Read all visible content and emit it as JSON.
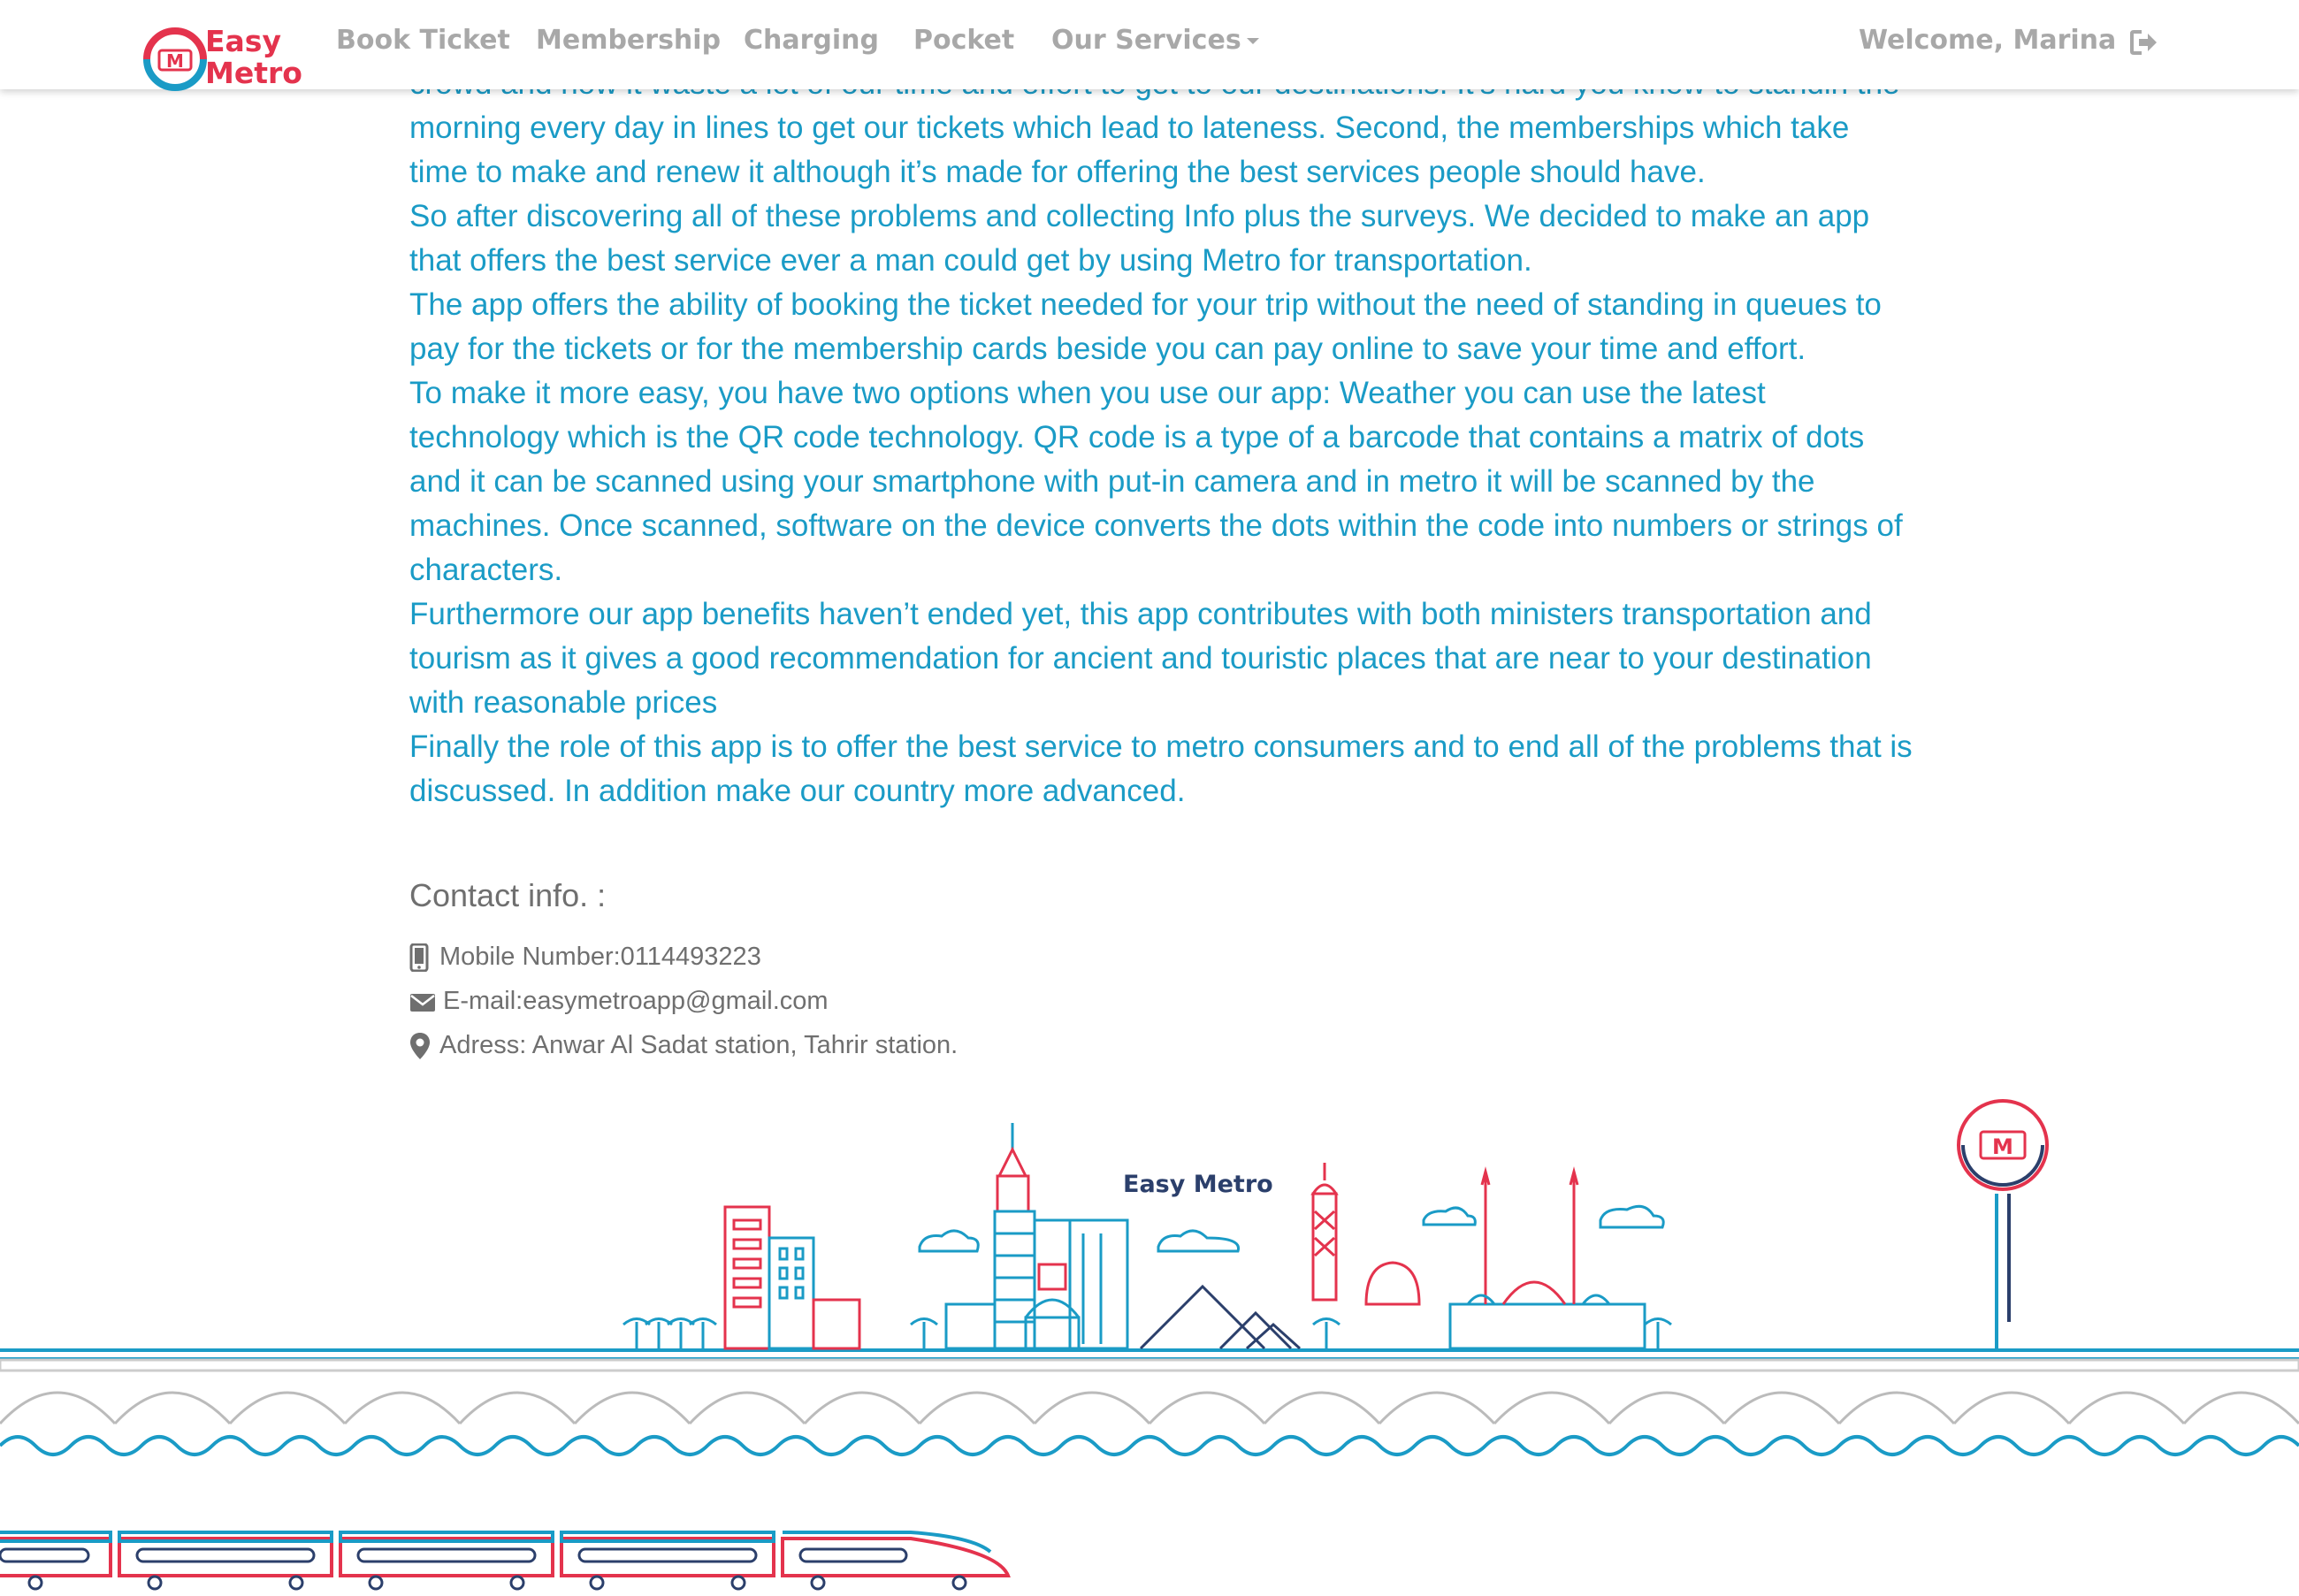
{
  "navbar": {
    "logo_line1": "Easy",
    "logo_line2": "Metro",
    "items": [
      "Book Ticket",
      "Membership",
      "Charging",
      "Pocket",
      "Our Services"
    ],
    "welcome": "Welcome, Marina",
    "signout_icon": "sign-out-icon"
  },
  "about": {
    "paragraphs": [
      "crowd and how it waste a lot of our time and effort to get to our destinations. It’s hard you know to standin the morning every day in lines to get our tickets which lead to lateness. Second, the memberships which take time to make and renew it although it’s made for offering the best services people should have.",
      "So after discovering all of these problems and collecting Info plus the surveys. We decided to make an app that offers the best service ever a man could get by using Metro for transportation.",
      "The app offers the ability of booking the ticket needed for your trip without the need of standing in queues to pay for the tickets or for the membership cards beside you can pay online to save your time and effort.",
      "To make it more easy, you have two options when you use our app: Weather you can use the latest technology which is the QR code technology. QR code is a type of a barcode that contains a matrix of dots and it can be scanned using your smartphone with put-in camera and in metro it will be scanned by the machines. Once scanned, software on the device converts the dots within the code into numbers or strings of characters.",
      "Furthermore our app benefits haven’t ended yet, this app contributes with both ministers transportation and tourism as it gives a good recommendation for ancient and touristic places that are near to your destination with reasonable prices",
      "Finally the role of this app is to offer the best service to metro consumers and to end all of the problems that is discussed. In addition make our country more advanced."
    ]
  },
  "contact": {
    "title": "Contact info. :",
    "mobile": "Mobile Number:0114493223",
    "email": "E-mail:easymetroapp@gmail.com",
    "address": "Adress: Anwar Al Sadat station, Tahrir station."
  },
  "footer": {
    "brand": "Easy Metro"
  },
  "colors": {
    "accent_blue": "#1a9bc6",
    "brand_red": "#e4334d",
    "navy": "#2b3f6b",
    "nav_gray": "#a8a8a8",
    "text_gray": "#6f6f6f"
  }
}
